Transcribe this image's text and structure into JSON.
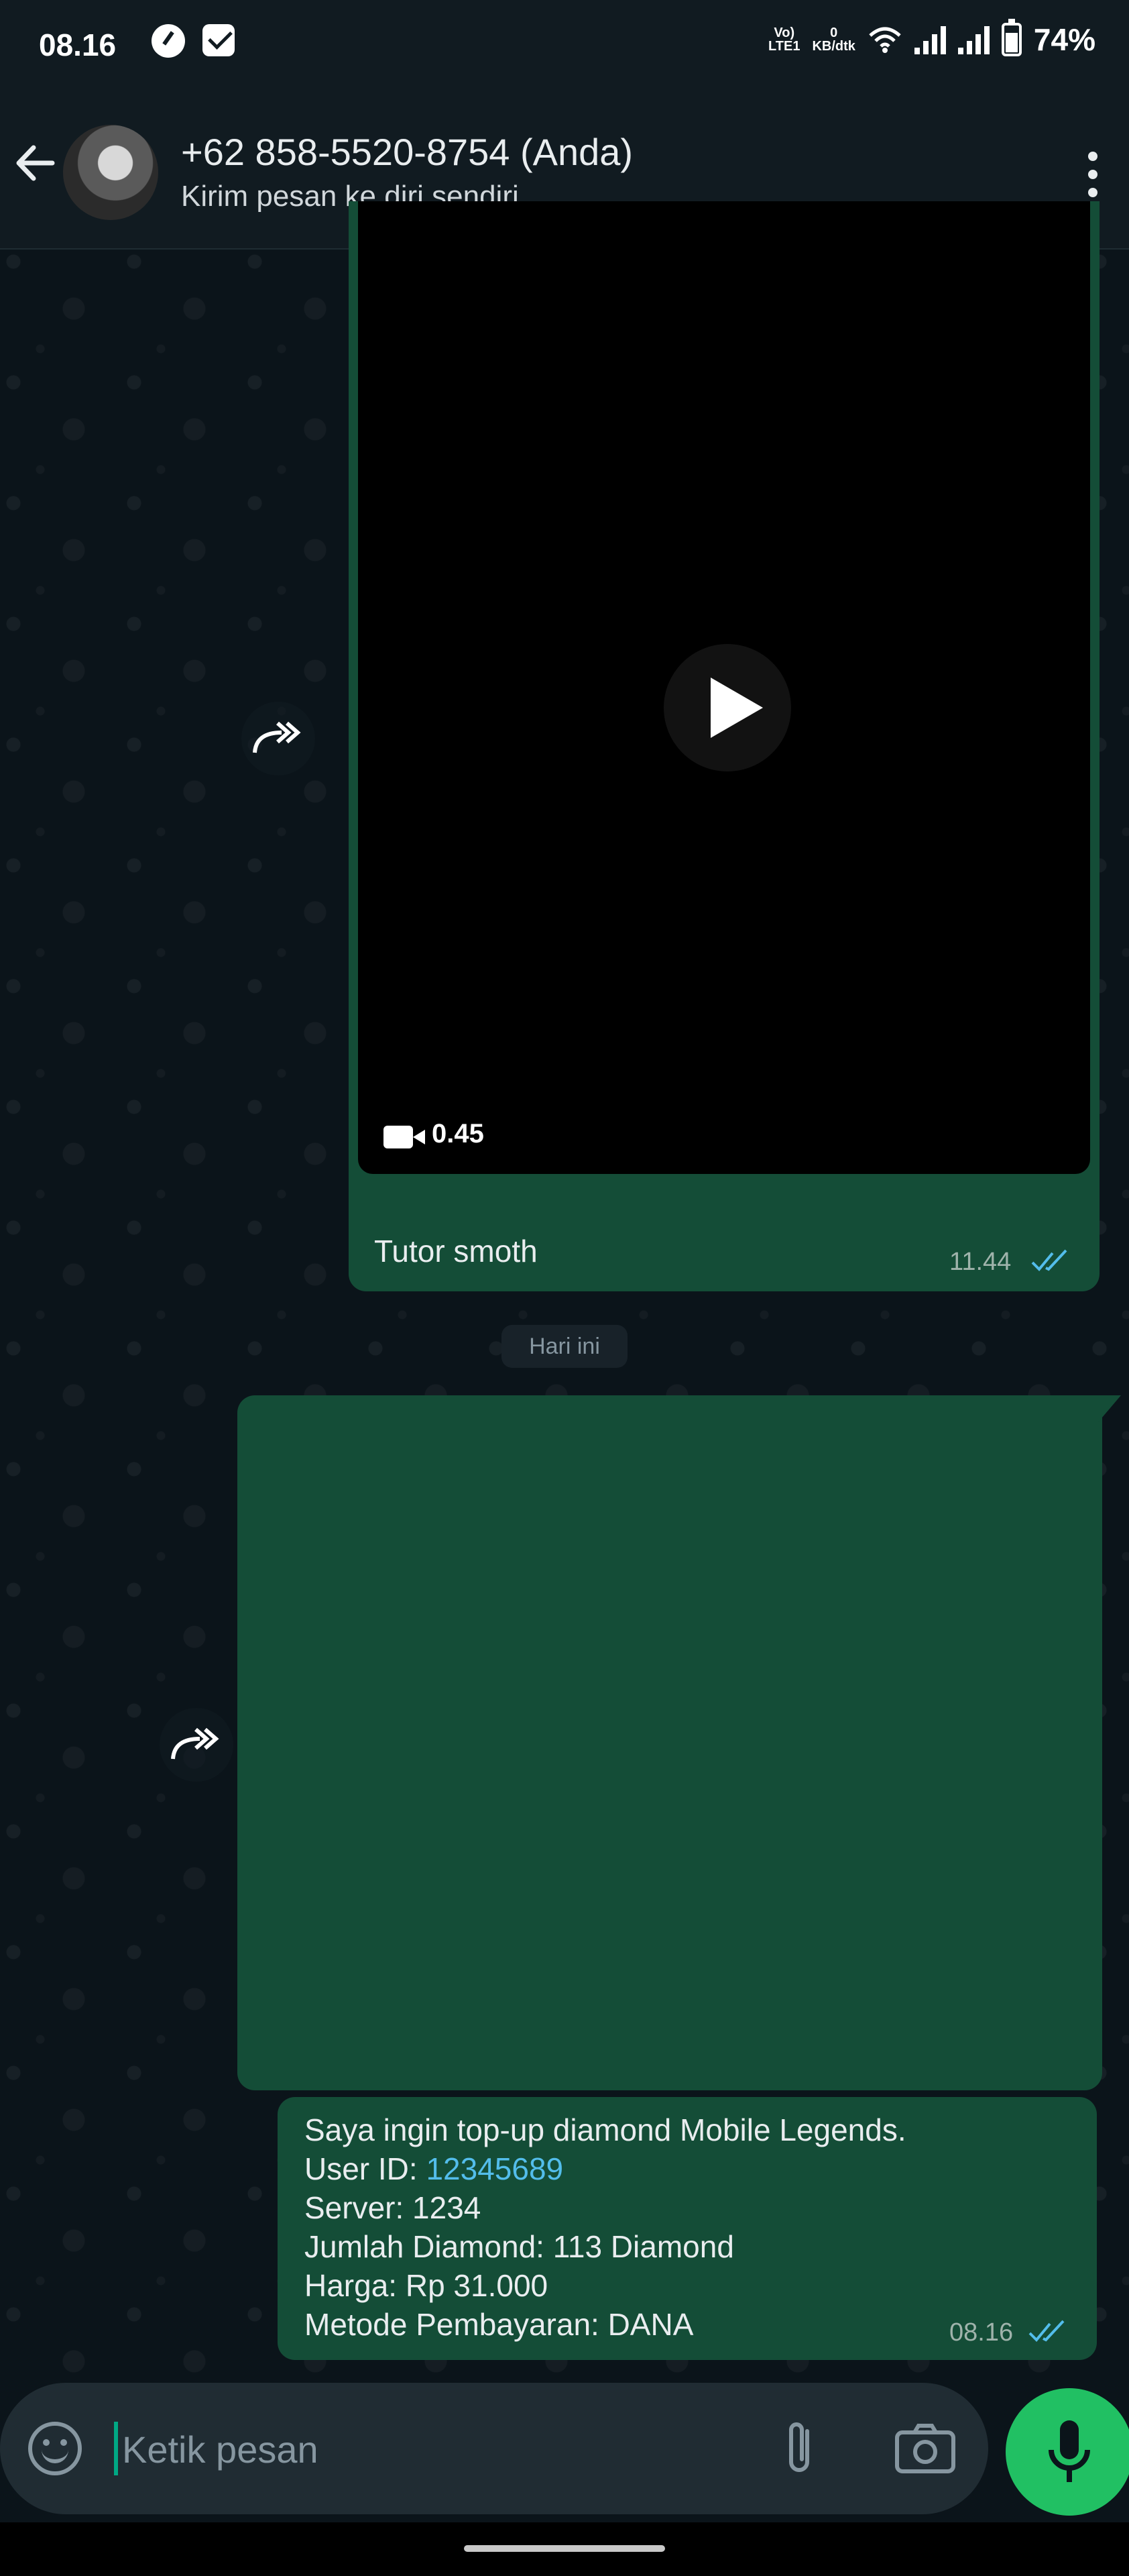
{
  "status_bar": {
    "time": "08.16",
    "network_top": "Vo)",
    "network_bottom": "LTE1",
    "speed_value": "0",
    "speed_unit": "KB/dtk",
    "battery": "74%"
  },
  "header": {
    "contact_name": "+62 858-5520-8754 (Anda)",
    "subtitle": "Kirim pesan ke diri sendiri"
  },
  "messages": {
    "video": {
      "duration": "0.45",
      "caption": "Tutor smoth",
      "time": "11.44"
    },
    "date_separator": "Hari ini",
    "text": {
      "line1": "Saya ingin top-up diamond Mobile Legends.",
      "user_id_label": "User ID: ",
      "user_id_value": "12345689",
      "line3": "Server: 1234",
      "line4": "Jumlah Diamond: 113 Diamond",
      "line5": "Harga: Rp 31.000",
      "line6": "Metode Pembayaran: DANA",
      "time": "08.16"
    }
  },
  "composer": {
    "placeholder": "Ketik pesan"
  },
  "icons": {
    "back": "arrow-left-icon",
    "menu": "more-vertical-icon",
    "forward": "forward-icon",
    "play": "play-icon",
    "video": "video-camera-icon",
    "ticks": "double-check-icon",
    "emoji": "emoji-icon",
    "attach": "paperclip-icon",
    "camera": "camera-icon",
    "mic": "microphone-icon"
  },
  "colors": {
    "background": "#0b141a",
    "header": "#111b21",
    "outgoing_bubble": "#144d37",
    "accent": "#21c063",
    "link": "#53bdeb",
    "read_ticks": "#53bdeb"
  }
}
